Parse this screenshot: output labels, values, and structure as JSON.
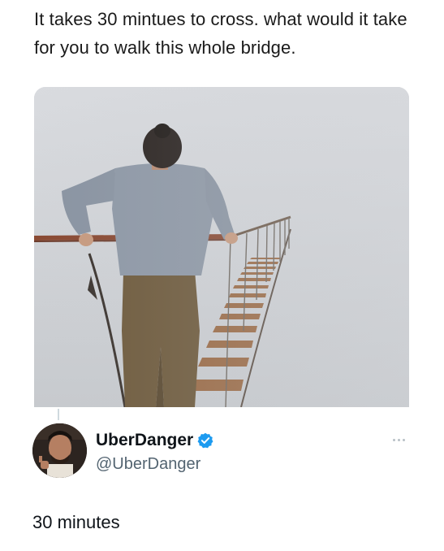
{
  "post": {
    "caption": "It takes 30 mintues to cross. what would it take for you to walk this whole bridge.",
    "image_alt": "Person walking on a rope bridge disappearing into fog"
  },
  "reply": {
    "display_name": "UberDanger",
    "handle": "@UberDanger",
    "verified": true,
    "text": "30 minutes",
    "icons": {
      "verified": "verified-badge-icon",
      "more": "more-options-icon"
    }
  },
  "colors": {
    "verified": "#1d9bf0",
    "handle": "#536471",
    "text": "#0f1419"
  }
}
